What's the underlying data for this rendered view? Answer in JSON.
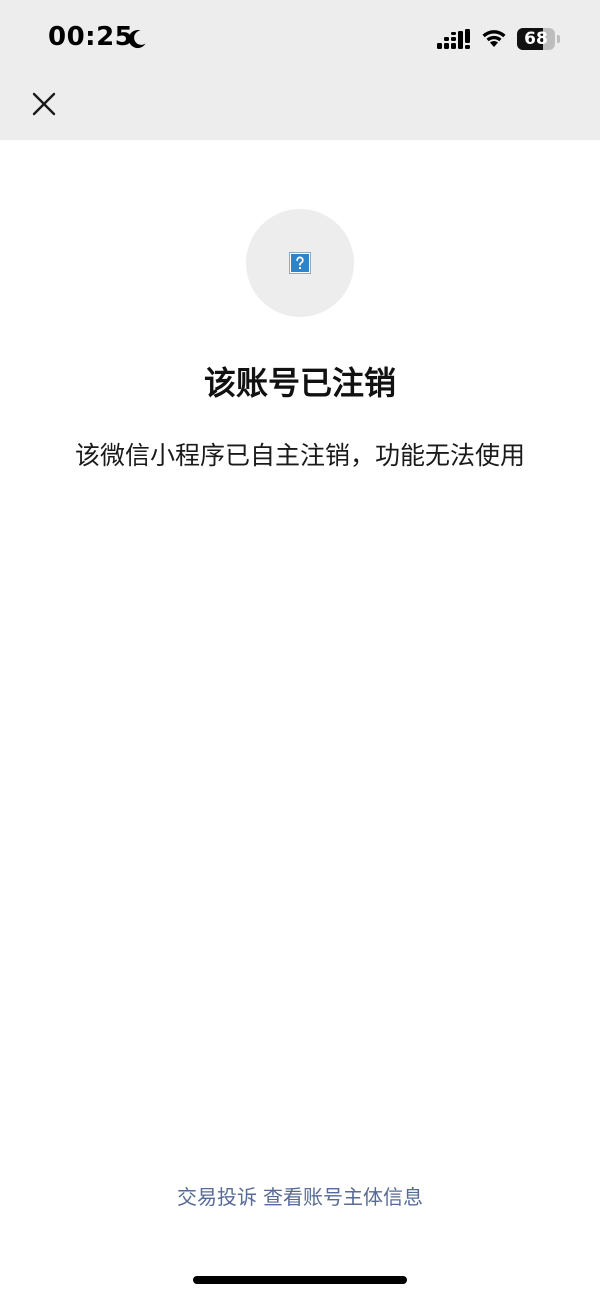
{
  "status_bar": {
    "time": "00:25",
    "battery_level": "68",
    "battery_fraction": 0.68,
    "icons": [
      "moon-icon",
      "signal-icon",
      "wifi-icon",
      "battery-icon"
    ]
  },
  "nav": {
    "close_icon": "close-icon"
  },
  "content": {
    "avatar_icon": "broken-image-icon",
    "title": "该账号已注销",
    "description": "该微信小程序已自主注销，功能无法使用"
  },
  "footer": {
    "complaint_link": "交易投诉",
    "account_info_link": "查看账号主体信息"
  },
  "colors": {
    "top_bar_bg": "#ededed",
    "link": "#576b95",
    "text": "#111111"
  }
}
